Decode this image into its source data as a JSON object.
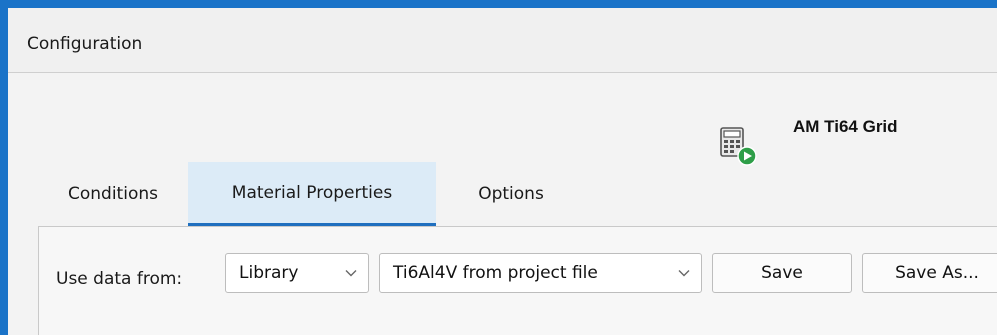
{
  "window": {
    "title": "Configuration",
    "accent_color": "#1a73c8"
  },
  "model": {
    "icon": "calculator-run-icon",
    "name": "AM Ti64 Grid"
  },
  "tabs": [
    {
      "label": "Conditions",
      "active": false
    },
    {
      "label": "Material Properties",
      "active": true
    },
    {
      "label": "Options",
      "active": false
    }
  ],
  "material_panel": {
    "use_data_label": "Use data from:",
    "source_select": {
      "value": "Library"
    },
    "material_select": {
      "value": "Ti6Al4V from project file"
    },
    "save_label": "Save",
    "save_as_label": "Save As..."
  }
}
